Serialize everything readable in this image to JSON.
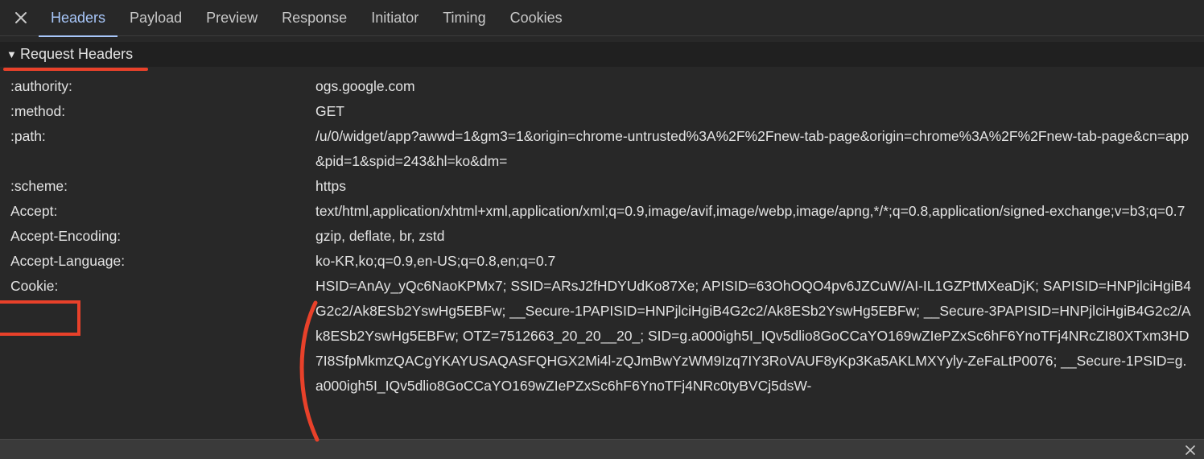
{
  "tabbar": {
    "close_icon": "close-icon",
    "tabs": [
      {
        "label": "Headers",
        "active": true
      },
      {
        "label": "Payload",
        "active": false
      },
      {
        "label": "Preview",
        "active": false
      },
      {
        "label": "Response",
        "active": false
      },
      {
        "label": "Initiator",
        "active": false
      },
      {
        "label": "Timing",
        "active": false
      },
      {
        "label": "Cookies",
        "active": false
      }
    ],
    "accent_color": "#a8c7fa"
  },
  "section": {
    "title": "Request Headers",
    "expanded_icon": "triangle-down-icon"
  },
  "headers": [
    {
      "name": ":authority:",
      "value": "ogs.google.com"
    },
    {
      "name": ":method:",
      "value": "GET"
    },
    {
      "name": ":path:",
      "value": "/u/0/widget/app?awwd=1&gm3=1&origin=chrome-untrusted%3A%2F%2Fnew-tab-page&origin=chrome%3A%2F%2Fnew-tab-page&cn=app&pid=1&spid=243&hl=ko&dm="
    },
    {
      "name": ":scheme:",
      "value": "https"
    },
    {
      "name": "Accept:",
      "value": "text/html,application/xhtml+xml,application/xml;q=0.9,image/avif,image/webp,image/apng,*/*;q=0.8,application/signed-exchange;v=b3;q=0.7"
    },
    {
      "name": "Accept-Encoding:",
      "value": "gzip, deflate, br, zstd"
    },
    {
      "name": "Accept-Language:",
      "value": "ko-KR,ko;q=0.9,en-US;q=0.8,en;q=0.7"
    },
    {
      "name": "Cookie:",
      "value": "HSID=AnAy_yQc6NaoKPMx7; SSID=ARsJ2fHDYUdKo87Xe; APISID=63OhOQO4pv6JZCuW/AI-IL1GZPtMXeaDjK; SAPISID=HNPjlciHgiB4G2c2/Ak8ESb2YswHg5EBFw; __Secure-1PAPISID=HNPjlciHgiB4G2c2/Ak8ESb2YswHg5EBFw; __Secure-3PAPISID=HNPjlciHgiB4G2c2/Ak8ESb2YswHg5EBFw; OTZ=7512663_20_20__20_; SID=g.a000igh5I_IQv5dlio8GoCCaYO169wZIePZxSc6hF6YnoTFj4NRcZI80XTxm3HD7I8SfpMkmzQACgYKAYUSAQASFQHGX2Mi4l-zQJmBwYzWM9Izq7IY3RoVAUF8yKp3Ka5AKLMXYyly-ZeFaLtP0076; __Secure-1PSID=g.a000igh5I_IQv5dlio8GoCCaYO169wZIePZxSc6hF6YnoTFj4NRc0tyBVCj5dsW-"
    }
  ],
  "bottom_bar": {
    "close_icon": "close-icon"
  },
  "annotation_color": "#e8412a"
}
